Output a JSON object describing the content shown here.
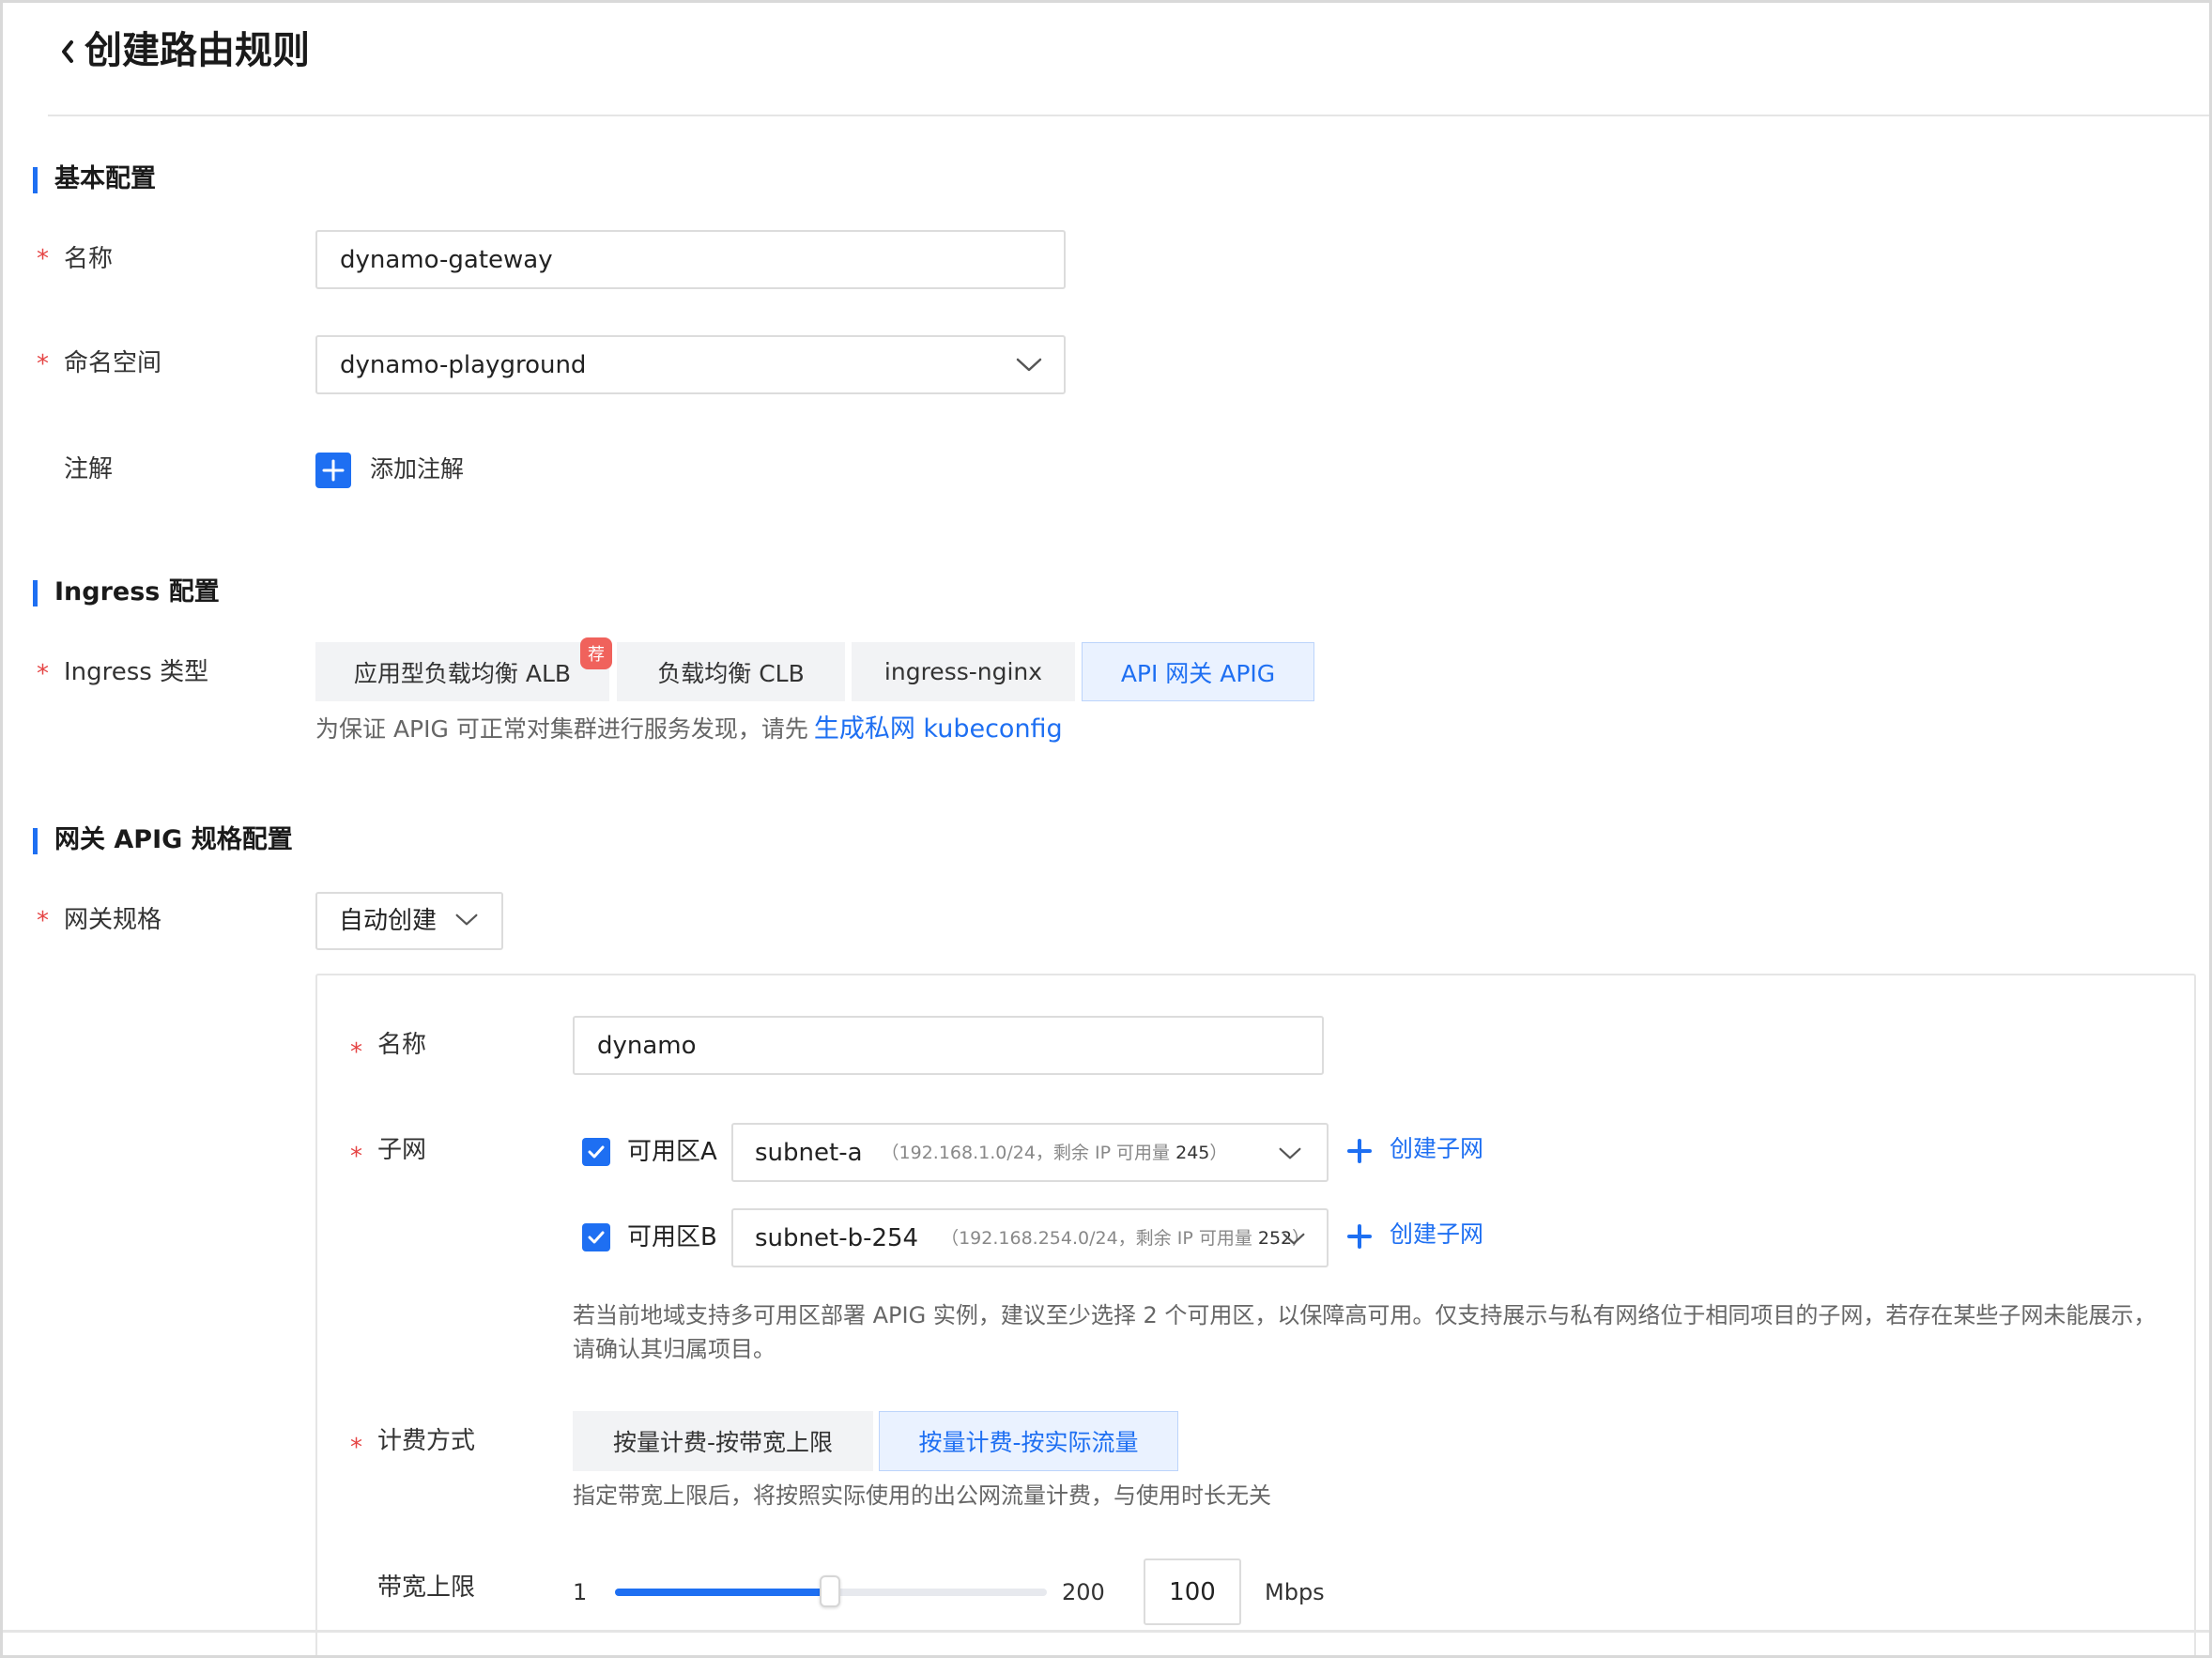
{
  "header": {
    "title": "创建路由规则"
  },
  "basic": {
    "section_title": "基本配置",
    "name_label": "名称",
    "name_value": "dynamo-gateway",
    "namespace_label": "命名空间",
    "namespace_value": "dynamo-playground",
    "annotation_label": "注解",
    "add_annotation": "添加注解"
  },
  "ingress": {
    "section_title": "Ingress 配置",
    "type_label": "Ingress 类型",
    "types": [
      "应用型负载均衡 ALB",
      "负载均衡 CLB",
      "ingress-nginx",
      "API 网关 APIG"
    ],
    "selected_type": "API 网关 APIG",
    "recommend_badge": "荐",
    "hint_prefix": "为保证 APIG 可正常对集群进行服务发现，请先",
    "hint_link": "生成私网 kubeconfig"
  },
  "gateway": {
    "section_title": "网关 APIG 规格配置",
    "spec_label": "网关规格",
    "spec_value": "自动创建",
    "name_label": "名称",
    "name_value": "dynamo",
    "subnet_label": "子网",
    "zones": [
      {
        "zone": "可用区A",
        "subnet": "subnet-a",
        "detail_prefix": "（192.168.1.0/24，剩余 IP 可用量",
        "count": "245",
        "detail_suffix": "）",
        "checked": true
      },
      {
        "zone": "可用区B",
        "subnet": "subnet-b-254",
        "detail_prefix": "（192.168.254.0/24，剩余 IP 可用量",
        "count": "252",
        "detail_suffix": "）",
        "checked": true
      }
    ],
    "create_subnet": "创建子网",
    "subnet_hint_line1": "若当前地域支持多可用区部署 APIG 实例，建议至少选择 2 个可用区，以保障高可用。仅支持展示与私有网络位于相同项目的子网，若存在某些子网未能展示，",
    "subnet_hint_line2": "请确认其归属项目。",
    "billing_label": "计费方式",
    "billing_options": [
      "按量计费-按带宽上限",
      "按量计费-按实际流量"
    ],
    "billing_selected": "按量计费-按实际流量",
    "billing_hint": "指定带宽上限后，将按照实际使用的出公网流量计费，与使用时长无关",
    "bandwidth_label": "带宽上限",
    "bandwidth_min": "1",
    "bandwidth_max": "200",
    "bandwidth_value": "100",
    "bandwidth_unit": "Mbps"
  },
  "colors": {
    "accent": "#1e6ff2",
    "required": "#e54545",
    "badge": "#f0625c"
  }
}
